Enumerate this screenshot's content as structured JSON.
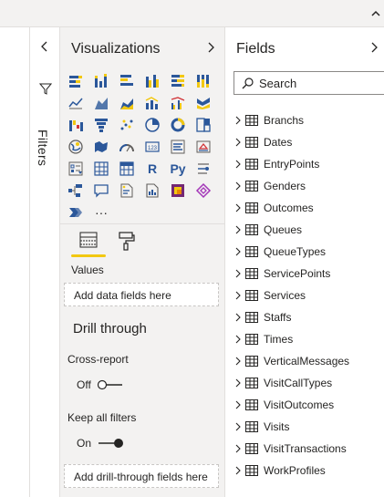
{
  "filters": {
    "label": "Filters"
  },
  "visualizations": {
    "title": "Visualizations",
    "icons": [
      "stacked-bar-chart-icon",
      "stacked-column-chart-icon",
      "clustered-bar-chart-icon",
      "clustered-column-chart-icon",
      "100-stacked-bar-chart-icon",
      "100-stacked-column-chart-icon",
      "line-chart-icon",
      "area-chart-icon",
      "stacked-area-chart-icon",
      "line-and-stacked-column-icon",
      "line-and-clustered-column-icon",
      "ribbon-chart-icon",
      "waterfall-chart-icon",
      "funnel-chart-icon",
      "scatter-chart-icon",
      "pie-chart-icon",
      "donut-chart-icon",
      "treemap-icon",
      "map-icon",
      "filled-map-icon",
      "gauge-icon",
      "card-icon",
      "multi-row-card-icon",
      "kpi-icon",
      "slicer-icon",
      "table-icon",
      "matrix-icon",
      "r-visual-icon",
      "python-visual-icon",
      "key-influencers-icon",
      "decomposition-tree-icon",
      "qa-icon",
      "smart-narrative-icon",
      "paginated-report-icon",
      "power-apps-icon",
      "power-automate-icon",
      "custom-visual-icon",
      "more-visuals-icon"
    ],
    "r_label": "R",
    "py_label": "Py",
    "more_label": "···",
    "values_label": "Values",
    "values_placeholder": "Add data fields here",
    "drill_title": "Drill through",
    "cross_report_label": "Cross-report",
    "cross_report_state": "Off",
    "keep_filters_label": "Keep all filters",
    "keep_filters_state": "On",
    "drill_placeholder": "Add drill-through fields here"
  },
  "fields": {
    "title": "Fields",
    "search_placeholder": "Search",
    "tables": [
      "Branchs",
      "Dates",
      "EntryPoints",
      "Genders",
      "Outcomes",
      "Queues",
      "QueueTypes",
      "ServicePoints",
      "Services",
      "Staffs",
      "Times",
      "VerticalMessages",
      "VisitCallTypes",
      "VisitOutcomes",
      "Visits",
      "VisitTransactions",
      "WorkProfiles"
    ]
  },
  "colors": {
    "accent": "#f2c811",
    "pane_bg": "#f3f2f1",
    "icon_blue": "#2b579a",
    "border": "#e1dfdd"
  }
}
